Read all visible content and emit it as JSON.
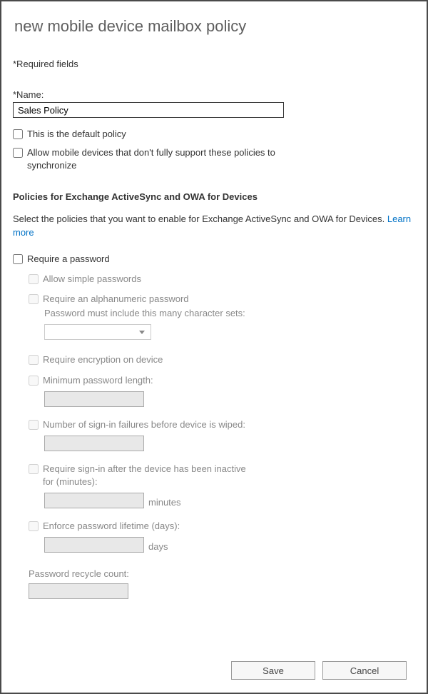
{
  "title": "new mobile device mailbox policy",
  "required_note": "*Required fields",
  "name_label": "*Name:",
  "name_value": "Sales Policy",
  "default_policy_label": "This is the default policy",
  "allow_unsupported_label": "Allow mobile devices that don't fully support these policies to synchronize",
  "section_header": "Policies for Exchange ActiveSync and OWA for Devices",
  "section_desc": "Select the policies that you want to enable for Exchange ActiveSync and OWA for Devices. ",
  "learn_more": "Learn more",
  "require_password_label": "Require a password",
  "allow_simple_label": "Allow simple passwords",
  "require_alpha_label": "Require an alphanumeric password",
  "char_sets_label": "Password must include this many character sets:",
  "require_encryption_label": "Require encryption on device",
  "min_length_label": "Minimum password length:",
  "signin_failures_label": "Number of sign-in failures before device is wiped:",
  "inactive_label": "Require sign-in after the device has been inactive for (minutes):",
  "inactive_unit": "minutes",
  "lifetime_label": "Enforce password lifetime (days):",
  "lifetime_unit": "days",
  "recycle_label": "Password recycle count:",
  "save_label": "Save",
  "cancel_label": "Cancel"
}
